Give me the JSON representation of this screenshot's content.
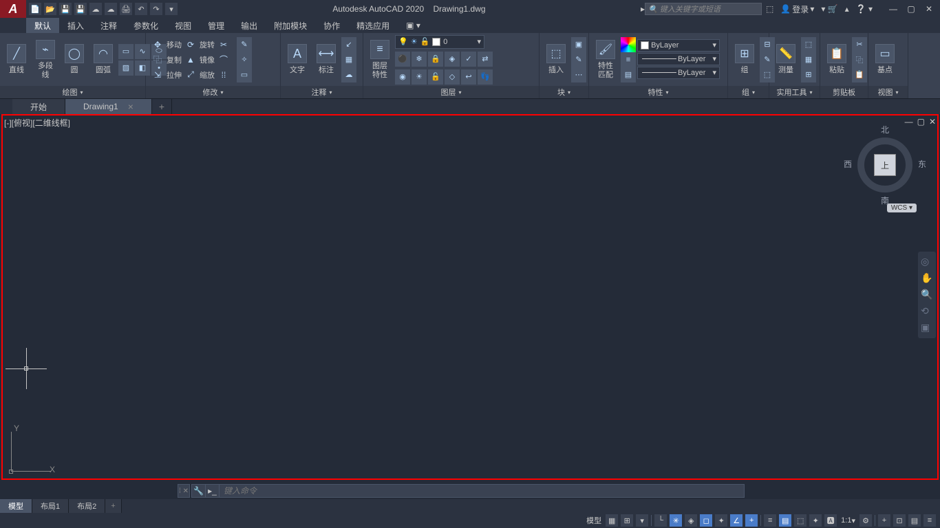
{
  "title": {
    "app": "Autodesk AutoCAD 2020",
    "file": "Drawing1.dwg"
  },
  "search": {
    "placeholder": "键入关键字或短语"
  },
  "login": {
    "label": "登录"
  },
  "menu": [
    "默认",
    "插入",
    "注释",
    "参数化",
    "视图",
    "管理",
    "输出",
    "附加模块",
    "协作",
    "精选应用"
  ],
  "active_menu": 0,
  "ribbon": {
    "draw": {
      "title": "绘图",
      "line": "直线",
      "polyline": "多段线",
      "circle": "圆",
      "arc": "圆弧"
    },
    "modify": {
      "title": "修改",
      "move": "移动",
      "rotate": "旋转",
      "copy": "复制",
      "mirror": "镜像",
      "stretch": "拉伸",
      "scale": "缩放"
    },
    "annot": {
      "title": "注释",
      "text": "文字",
      "dim": "标注"
    },
    "layer": {
      "title": "图层",
      "btn": "图层\n特性",
      "current": "0"
    },
    "block": {
      "title": "块",
      "insert": "插入"
    },
    "props": {
      "title": "特性",
      "btn": "特性\n匹配",
      "bylayer": "ByLayer"
    },
    "group": {
      "title": "组",
      "btn": "组"
    },
    "util": {
      "title": "实用工具",
      "measure": "测量"
    },
    "clip": {
      "title": "剪贴板",
      "paste": "粘贴"
    },
    "view": {
      "title": "视图",
      "base": "基点"
    }
  },
  "file_tabs": [
    {
      "label": "开始",
      "closable": false
    },
    {
      "label": "Drawing1",
      "closable": true
    }
  ],
  "active_file_tab": 1,
  "viewport": {
    "label": "[-][俯视][二维线框]"
  },
  "viewcube": {
    "top": "上",
    "n": "北",
    "s": "南",
    "e": "东",
    "w": "西",
    "wcs": "WCS"
  },
  "ucs": {
    "x": "X",
    "y": "Y"
  },
  "command": {
    "placeholder": "键入命令"
  },
  "layout_tabs": [
    "模型",
    "布局1",
    "布局2"
  ],
  "active_layout_tab": 0,
  "statusbar": {
    "model": "模型",
    "scale": "1:1"
  }
}
